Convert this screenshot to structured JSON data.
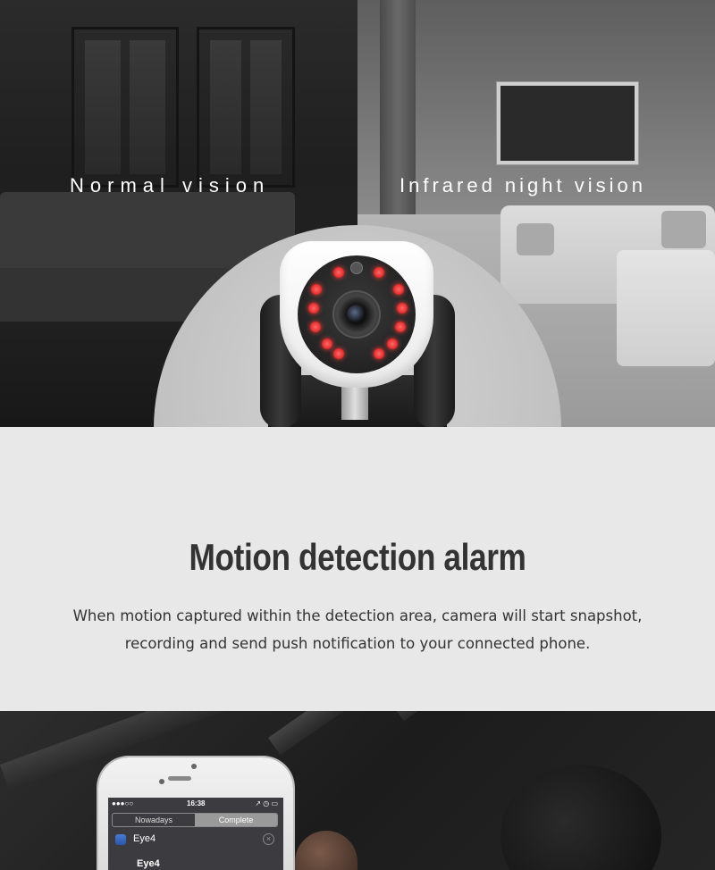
{
  "hero": {
    "left_label": "Normal vision",
    "right_label": "Infrared night vision"
  },
  "feature": {
    "title": "Motion detection alarm",
    "description_line1": "When motion captured within the detection area, camera will start snapshot,",
    "description_line2": "recording and send push notification to your connected phone."
  },
  "phone_screen": {
    "status_time": "16:38",
    "status_signal": "●●●○○",
    "status_right": "↗ ◷ ▭",
    "tabs": [
      "Nowadays",
      "Complete"
    ],
    "active_tab": "Complete",
    "notification_app": "Eye4",
    "notification_title": "Eye4"
  },
  "colors": {
    "ir_led": "#e53030",
    "section_bg": "#e8e8e8",
    "title_text": "#333333"
  }
}
